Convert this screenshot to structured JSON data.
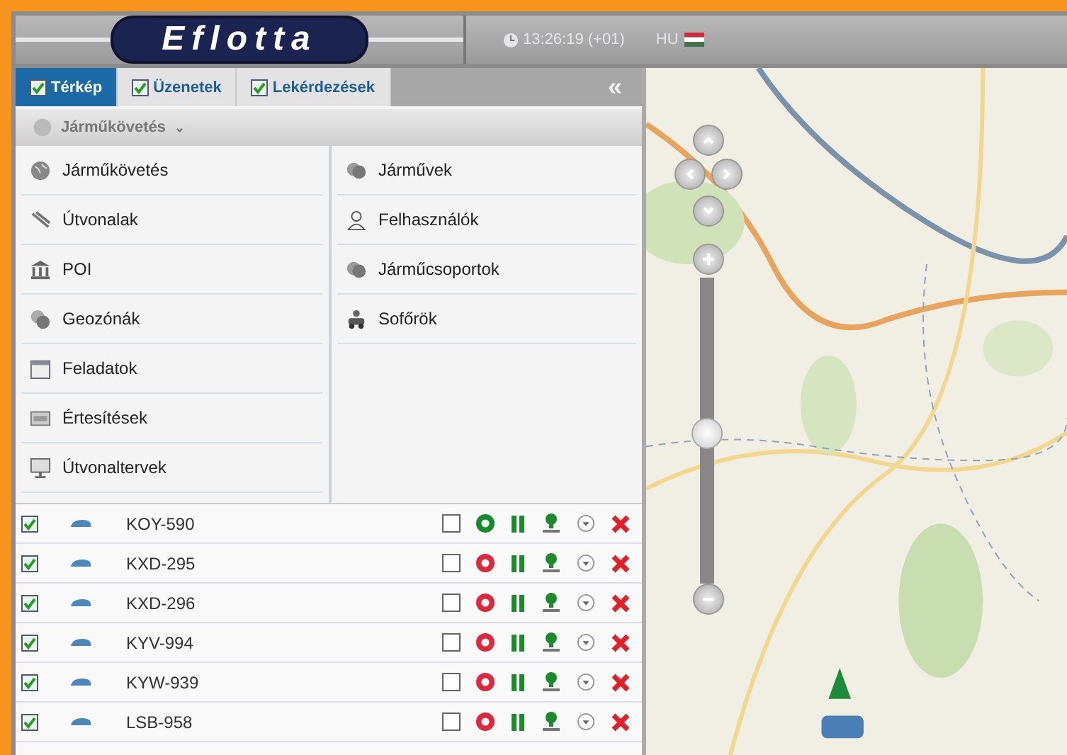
{
  "header": {
    "logo": "Eflotta",
    "clock": "13:26:19 (+01)",
    "language": "HU"
  },
  "tabs": [
    {
      "label": "Térkép",
      "checked": true,
      "selected": true
    },
    {
      "label": "Üzenetek",
      "checked": true,
      "selected": false
    },
    {
      "label": "Lekérdezések",
      "checked": true,
      "selected": false
    }
  ],
  "collapse": "«",
  "section": {
    "title": "Járműkövetés",
    "caret": "⌄"
  },
  "menu": {
    "left": [
      {
        "label": "Járműkövetés"
      },
      {
        "label": "Útvonalak"
      },
      {
        "label": "POI"
      },
      {
        "label": "Geozónák"
      },
      {
        "label": "Feladatok"
      },
      {
        "label": "Értesítések"
      },
      {
        "label": "Útvonaltervek"
      }
    ],
    "right": [
      {
        "label": "Járművek"
      },
      {
        "label": "Felhasználók"
      },
      {
        "label": "Járműcsoportok"
      },
      {
        "label": "Sofőrök"
      }
    ]
  },
  "vehicles": [
    {
      "plate": "KOY-590",
      "checked": true,
      "selected": false,
      "online": true
    },
    {
      "plate": "KXD-295",
      "checked": true,
      "selected": false,
      "online": false
    },
    {
      "plate": "KXD-296",
      "checked": true,
      "selected": false,
      "online": false
    },
    {
      "plate": "KYV-994",
      "checked": true,
      "selected": false,
      "online": false
    },
    {
      "plate": "KYW-939",
      "checked": true,
      "selected": false,
      "online": false
    },
    {
      "plate": "LSB-958",
      "checked": true,
      "selected": false,
      "online": false
    }
  ],
  "map": {
    "zoom": {
      "level": 0.49
    }
  }
}
